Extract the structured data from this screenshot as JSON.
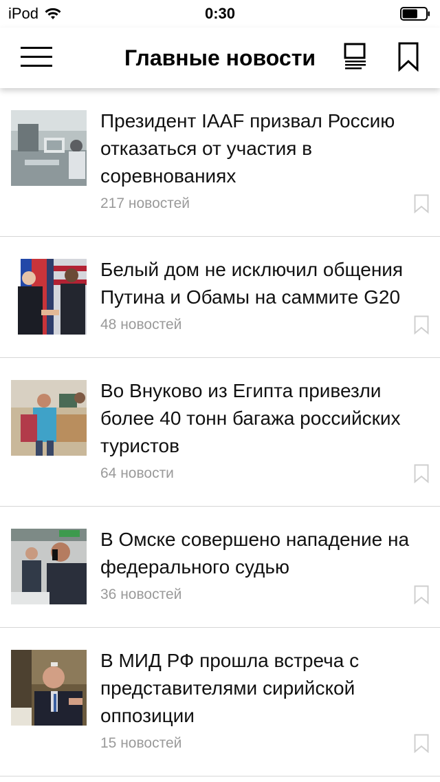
{
  "status": {
    "device": "iPod",
    "time": "0:30",
    "battery_level": 0.65
  },
  "header": {
    "title": "Главные новости"
  },
  "icons": {
    "menu": "hamburger-menu-icon",
    "list": "list-view-icon",
    "bookmark": "bookmark-icon",
    "wifi": "wifi-icon",
    "battery": "battery-icon"
  },
  "colors": {
    "count_text": "#9a9a9a",
    "divider": "#d6d6d6",
    "icon_gray": "#cfcfcf"
  },
  "news": [
    {
      "headline": "Президент IAAF призвал Россию отказаться от участия в соревнованиях",
      "count": "217 новостей"
    },
    {
      "headline": "Белый дом не исключил общения Путина и Обамы на саммите G20",
      "count": "48 новостей"
    },
    {
      "headline": "Во Внуково из Египта привезли более 40 тонн багажа российских туристов",
      "count": "64 новости"
    },
    {
      "headline": "В Омске совершено нападение на федерального судью",
      "count": "36 новостей"
    },
    {
      "headline": "В МИД РФ прошла встреча с представителями сирийской оппозиции",
      "count": "15 новостей"
    }
  ]
}
